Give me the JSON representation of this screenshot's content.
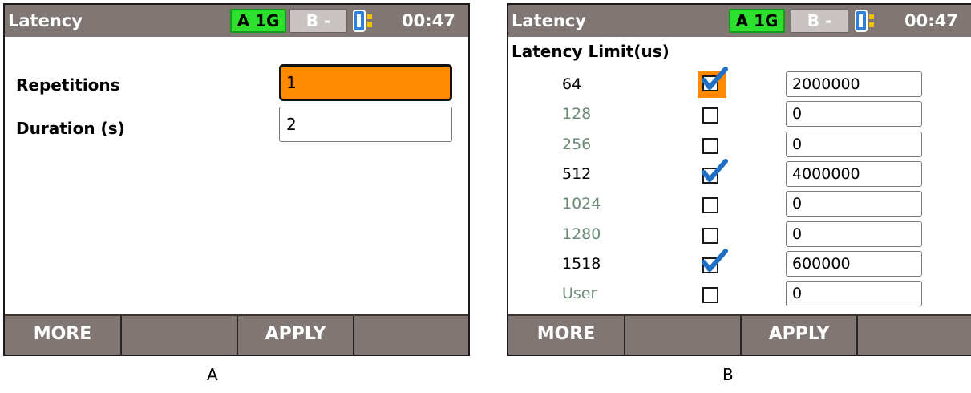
{
  "screen_a": {
    "title": "Latency",
    "port_a": "A 1G",
    "port_b": "B -",
    "time": "00:47",
    "repetitions_label": "Repetitions",
    "repetitions_value": "1",
    "duration_label": "Duration (s)",
    "duration_value": "2",
    "softkeys": [
      "MORE",
      "",
      "APPLY",
      ""
    ]
  },
  "screen_b": {
    "title": "Latency",
    "port_a": "A 1G",
    "port_b": "B -",
    "time": "00:47",
    "section_label": "Latency Limit(us)",
    "rows": [
      {
        "size": "64",
        "checked": true,
        "value": "2000000"
      },
      {
        "size": "128",
        "checked": false,
        "value": "0"
      },
      {
        "size": "256",
        "checked": false,
        "value": "0"
      },
      {
        "size": "512",
        "checked": true,
        "value": "4000000"
      },
      {
        "size": "1024",
        "checked": false,
        "value": "0"
      },
      {
        "size": "1280",
        "checked": false,
        "value": "0"
      },
      {
        "size": "1518",
        "checked": true,
        "value": "600000"
      },
      {
        "size": "User",
        "checked": false,
        "value": "0"
      }
    ],
    "softkeys": [
      "MORE",
      "",
      "APPLY",
      ""
    ]
  },
  "captions": {
    "a": "A",
    "b": "B"
  },
  "colors": {
    "titlebar": "#807774",
    "port_a_active": "#2ee02e",
    "focus_orange": "#ff8a00",
    "check_blue": "#1f6fc5"
  },
  "icons": {
    "port_status": "port-connector-icon",
    "check": "checkmark-icon"
  }
}
